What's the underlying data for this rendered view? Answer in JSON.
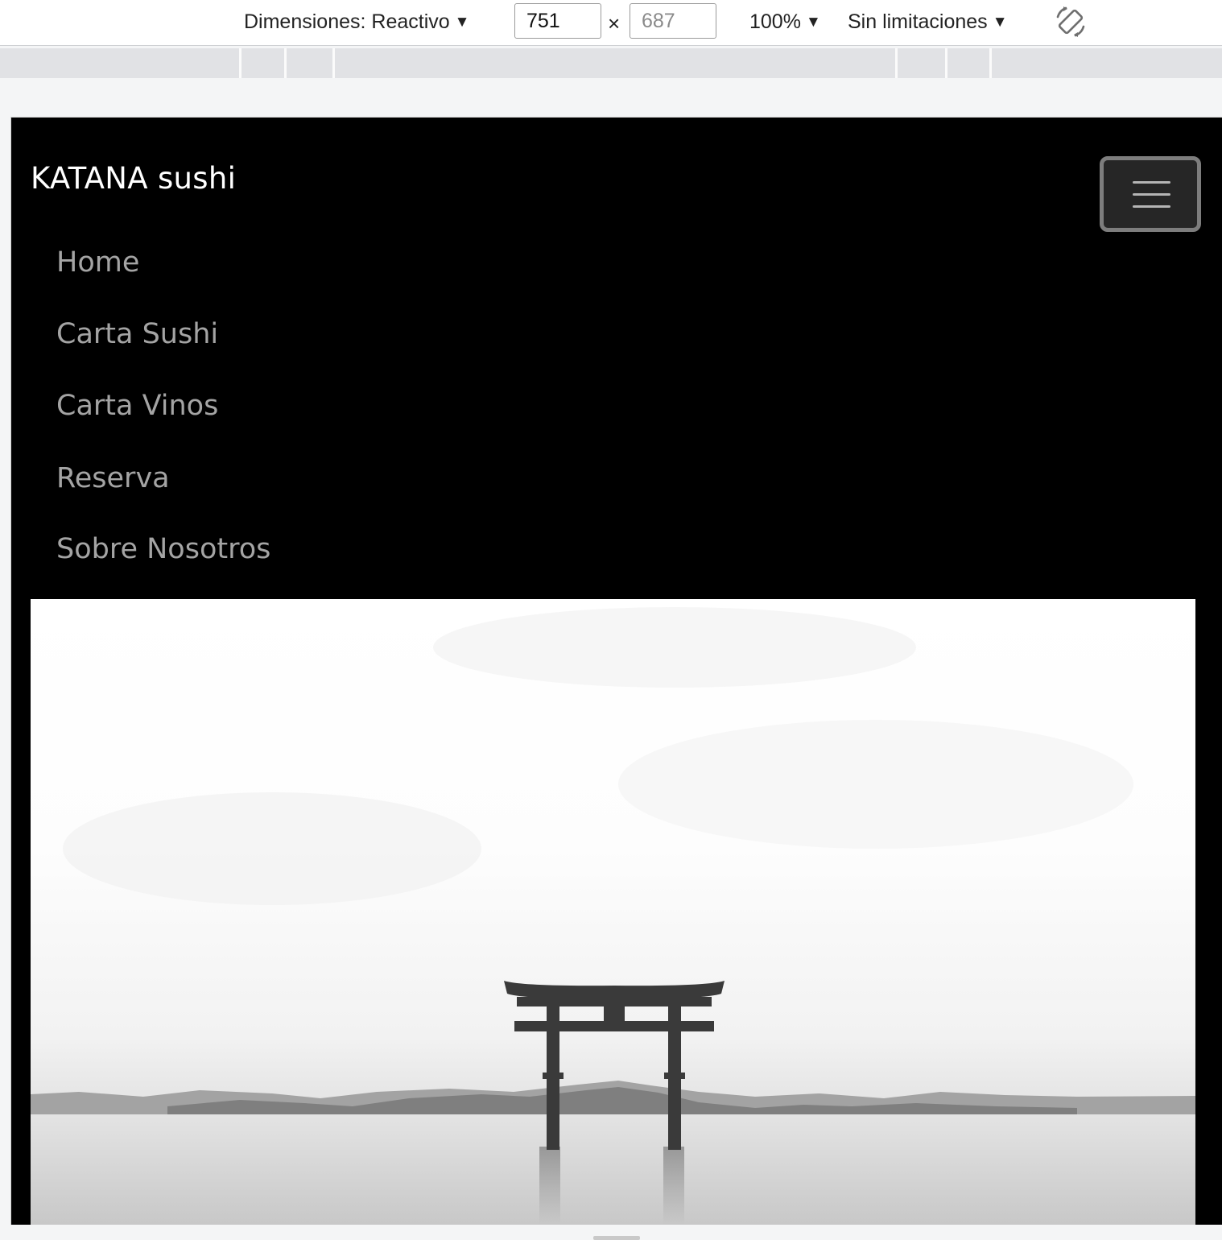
{
  "devtools": {
    "dimensions_label": "Dimensiones: Reactivo",
    "width_value": "751",
    "height_placeholder": "687",
    "times_symbol": "×",
    "zoom_label": "100%",
    "throttling_label": "Sin limitaciones",
    "caret": "▼",
    "rotate_icon": "rotate-device-icon"
  },
  "navbar": {
    "brand": "KATANA sushi",
    "toggler_icon": "hamburger-menu-icon",
    "links": [
      "Home",
      "Carta Sushi",
      "Carta Vinos",
      "Reserva",
      "Sobre Nosotros"
    ]
  },
  "hero": {
    "image": "torii-gate-in-lake-photo"
  },
  "colors": {
    "page_background": "#000000",
    "brand_text": "#ffffff",
    "nav_link_text": "#a4a4a4",
    "toggler_border": "#7d7d7d"
  }
}
